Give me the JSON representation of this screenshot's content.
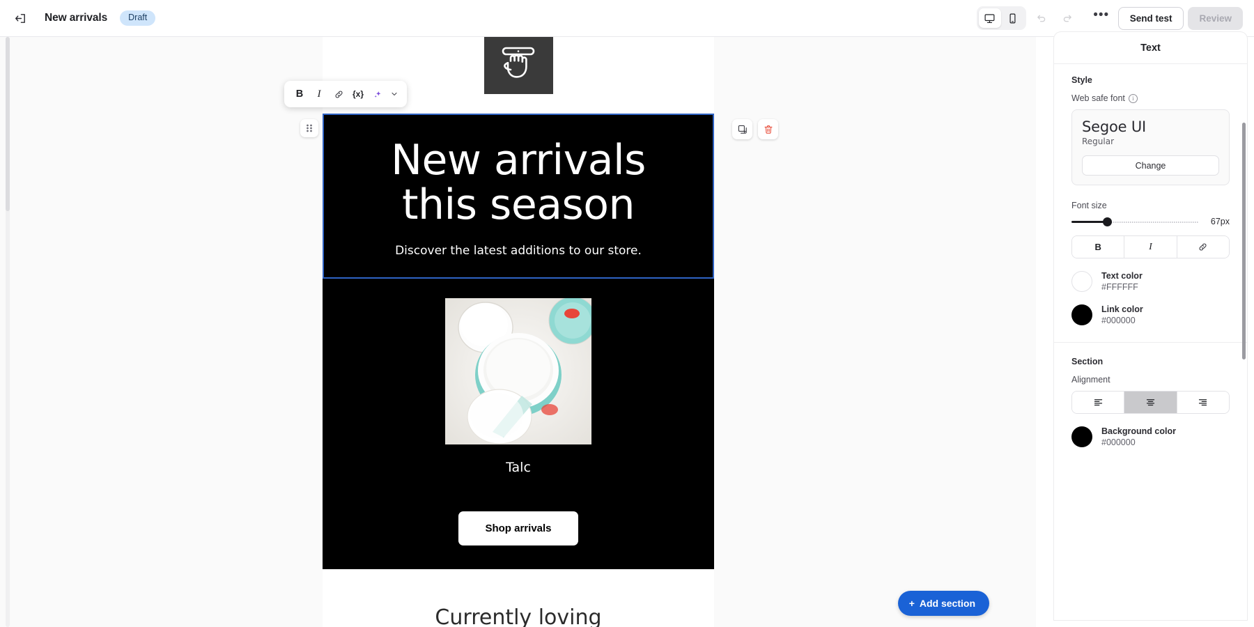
{
  "topbar": {
    "exit_icon": "exit-icon",
    "doc_title": "New arrivals",
    "status": "Draft",
    "device_desktop_icon": "desktop-icon",
    "device_mobile_icon": "mobile-icon",
    "undo_icon": "undo-icon",
    "redo_icon": "redo-icon",
    "more_label": "•••",
    "send_test_label": "Send test",
    "review_label": "Review"
  },
  "float_toolbar": {
    "bold_label": "B",
    "italic_label": "I",
    "link_icon": "link-icon",
    "merge_tag_label": "{x}",
    "ai_icon": "sparkle-icon",
    "chevron_icon": "chevron-down-icon"
  },
  "block_controls": {
    "drag_handle_icon": "drag-handle-icon",
    "duplicate_icon": "duplicate-icon",
    "delete_icon": "trash-icon"
  },
  "email": {
    "logo_icon": "pointing-hand-logo",
    "headline_line1": "New arrivals",
    "headline_line2": "this season",
    "subheadline": "Discover the latest additions to our store.",
    "product_caption": "Talc",
    "cta_label": "Shop arrivals",
    "next_section_heading": "Currently loving"
  },
  "canvas": {
    "add_section_label": "Add section",
    "add_section_plus": "+"
  },
  "panel": {
    "title": "Text",
    "style_group": "Style",
    "web_safe_font_label": "Web safe font",
    "info_icon": "info-icon",
    "font_name": "Segoe UI",
    "font_weight": "Regular",
    "change_label": "Change",
    "font_size_label": "Font size",
    "font_size_value": "67px",
    "format_bold": "B",
    "format_italic": "I",
    "format_link_icon": "link-icon",
    "text_color_label": "Text color",
    "text_color_hex": "#FFFFFF",
    "link_color_label": "Link color",
    "link_color_hex": "#000000",
    "section_group": "Section",
    "alignment_label": "Alignment",
    "align_left_icon": "align-left-icon",
    "align_center_icon": "align-center-icon",
    "align_right_icon": "align-right-icon",
    "background_color_label": "Background color",
    "background_color_hex": "#000000"
  },
  "colors": {
    "accent_blue": "#1a62d6",
    "draft_badge_bg": "#cfe5fb",
    "selection_outline": "#2f63c4",
    "email_bg": "#000000",
    "text_white": "#FFFFFF",
    "delete_red": "#e8513f",
    "ai_purple": "#7c4ddb"
  }
}
